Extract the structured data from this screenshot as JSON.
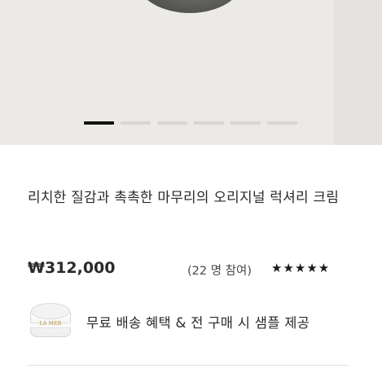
{
  "product": {
    "title": "리치한 질감과 촉촉한 마무리의 오리지널 럭셔리 크림",
    "price": "₩312,000",
    "reviews": "(22 명 참여)",
    "rating_stars": "★★★★★",
    "rating_value": 5,
    "rating_max": 5
  },
  "carousel": {
    "total_slides": 6,
    "active_index": 0
  },
  "promo": {
    "text": "무료 배송 혜택 & 전 구매 시 샘플 제공",
    "thumb_logo": "LA MER"
  },
  "colors": {
    "hero_bg": "#eceae6",
    "active_dot": "#111111",
    "inactive_dot": "#d7d6d3"
  }
}
